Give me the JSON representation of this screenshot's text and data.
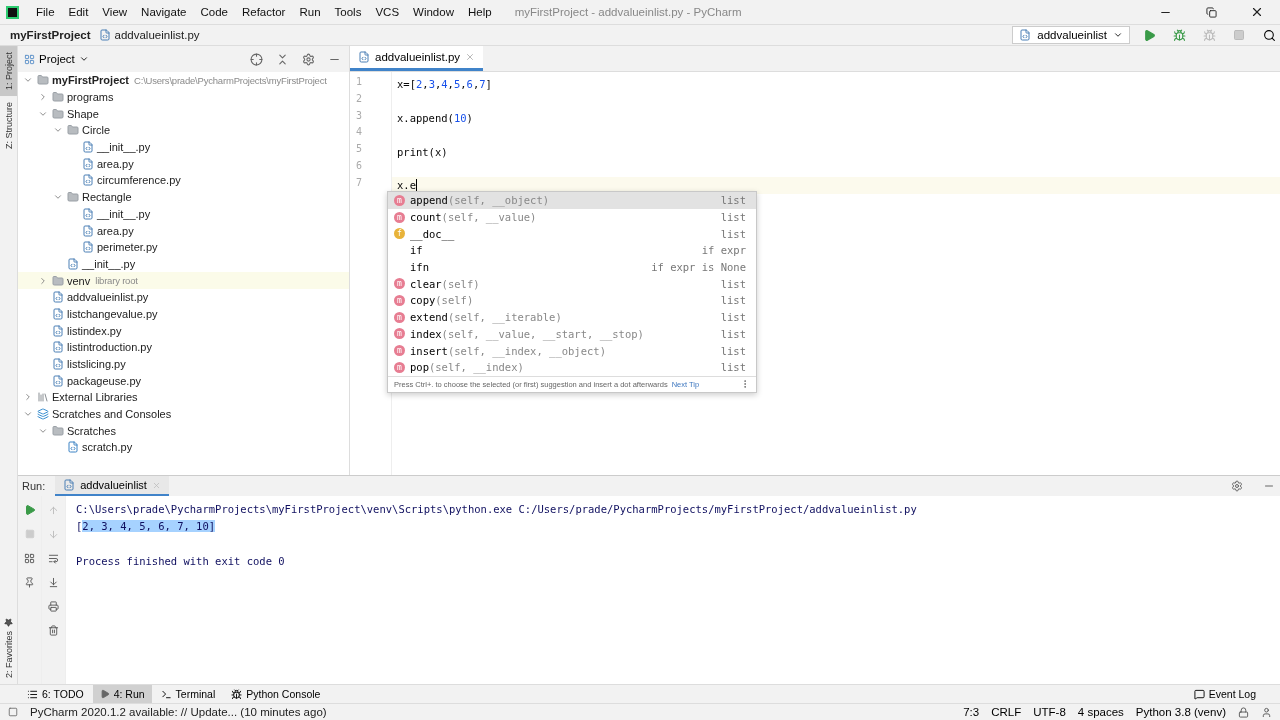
{
  "menu": [
    "File",
    "Edit",
    "View",
    "Navigate",
    "Code",
    "Refactor",
    "Run",
    "Tools",
    "VCS",
    "Window",
    "Help"
  ],
  "window": {
    "title": "myFirstProject - addvalueinlist.py - PyCharm"
  },
  "breadcrumb": [
    {
      "label": "myFirstProject",
      "kind": "project"
    },
    {
      "label": "addvalueinlist.py",
      "kind": "file"
    }
  ],
  "run_config": {
    "label": "addvalueinlist"
  },
  "side_tabs_top": [
    {
      "label": "1: Project",
      "selected": true
    },
    {
      "label": "Z: Structure",
      "selected": false
    }
  ],
  "side_tabs_bottom": [
    {
      "label": "2: Favorites",
      "selected": false
    }
  ],
  "project_panel": {
    "title": "Project",
    "tree": [
      {
        "name": "myFirstProject",
        "kind": "folder",
        "bold": true,
        "note": "C:\\Users\\prade\\PycharmProjects\\myFirstProject",
        "expanded": true,
        "children": [
          {
            "name": "programs",
            "kind": "folder",
            "expanded": false
          },
          {
            "name": "Shape",
            "kind": "folder",
            "expanded": true,
            "children": [
              {
                "name": "Circle",
                "kind": "folder",
                "expanded": true,
                "children": [
                  {
                    "name": "__init__.py",
                    "kind": "file"
                  },
                  {
                    "name": "area.py",
                    "kind": "file"
                  },
                  {
                    "name": "circumference.py",
                    "kind": "file"
                  }
                ]
              },
              {
                "name": "Rectangle",
                "kind": "folder",
                "expanded": true,
                "children": [
                  {
                    "name": "__init__.py",
                    "kind": "file"
                  },
                  {
                    "name": "area.py",
                    "kind": "file"
                  },
                  {
                    "name": "perimeter.py",
                    "kind": "file"
                  }
                ]
              },
              {
                "name": "__init__.py",
                "kind": "file"
              }
            ]
          },
          {
            "name": "venv",
            "kind": "folder",
            "note": "library root",
            "highlighted": true,
            "expanded": false
          },
          {
            "name": "addvalueinlist.py",
            "kind": "file"
          },
          {
            "name": "listchangevalue.py",
            "kind": "file"
          },
          {
            "name": "listindex.py",
            "kind": "file"
          },
          {
            "name": "listintroduction.py",
            "kind": "file"
          },
          {
            "name": "listslicing.py",
            "kind": "file"
          },
          {
            "name": "packageuse.py",
            "kind": "file"
          }
        ]
      },
      {
        "name": "External Libraries",
        "kind": "library",
        "expanded": false
      },
      {
        "name": "Scratches and Consoles",
        "kind": "scratches",
        "expanded": true,
        "children": [
          {
            "name": "Scratches",
            "kind": "folder",
            "expanded": true,
            "children": [
              {
                "name": "scratch.py",
                "kind": "scratch"
              }
            ]
          }
        ]
      }
    ]
  },
  "editor": {
    "tab": "addvalueinlist.py",
    "lines": [
      {
        "number": "1",
        "code": "x=[2,3,4,5,6,7]",
        "current": false
      },
      {
        "number": "2",
        "current": false
      },
      {
        "number": "3",
        "code": "x.append(10)",
        "current": false
      },
      {
        "number": "4",
        "current": false
      },
      {
        "number": "5",
        "code": "print(x)",
        "current": false
      },
      {
        "number": "6",
        "current": false
      },
      {
        "number": "7",
        "code": "x.e",
        "current": true
      }
    ]
  },
  "completion": {
    "items": [
      {
        "kind": "method",
        "icon": "m",
        "name": "append",
        "params": "(self, __object)",
        "type": "list",
        "selected": true
      },
      {
        "kind": "method",
        "icon": "m",
        "name": "count",
        "params": "(self, __value)",
        "type": "list",
        "selected": false
      },
      {
        "kind": "field",
        "icon": "f",
        "name": "__doc__",
        "type": "list",
        "selected": false
      },
      {
        "kind": "template",
        "name": "if",
        "type": "if expr",
        "selected": false
      },
      {
        "kind": "template",
        "name": "ifn",
        "type": "if expr is None",
        "selected": false
      },
      {
        "kind": "method",
        "icon": "m",
        "name": "clear",
        "params": "(self)",
        "type": "list",
        "selected": false
      },
      {
        "kind": "method",
        "icon": "m",
        "name": "copy",
        "params": "(self)",
        "type": "list",
        "selected": false
      },
      {
        "kind": "method",
        "icon": "m",
        "name": "extend",
        "params": "(self, __iterable)",
        "type": "list",
        "selected": false
      },
      {
        "kind": "method",
        "icon": "m",
        "name": "index",
        "params": "(self, __value, __start, __stop)",
        "type": "list",
        "selected": false
      },
      {
        "kind": "method",
        "icon": "m",
        "name": "insert",
        "params": "(self, __index, __object)",
        "type": "list",
        "selected": false
      },
      {
        "kind": "method",
        "icon": "m",
        "name": "pop",
        "params": "(self, __index)",
        "type": "list",
        "selected": false
      }
    ],
    "hint": "Press Ctrl+. to choose the selected (or first) suggestion and insert a dot afterwards",
    "tip_link": "Next Tip"
  },
  "run_panel": {
    "label": "Run:",
    "tab": "addvalueinlist",
    "output": [
      {
        "text": "C:\\Users\\prade\\PycharmProjects\\myFirstProject\\venv\\Scripts\\python.exe C:/Users/prade/PycharmProjects/myFirstProject/addvalueinlist.py"
      },
      {
        "text": "[",
        "selected_text": "2, 3, 4, 5, 6, 7, 10]"
      },
      {
        "text": "Process finished with exit code 0",
        "gap_before": true
      }
    ]
  },
  "tool_tabs": [
    {
      "label": "6: TODO",
      "kind": "todo",
      "selected": false
    },
    {
      "label": "4: Run",
      "kind": "run",
      "selected": true
    },
    {
      "label": "Terminal",
      "kind": "terminal",
      "selected": false
    },
    {
      "label": "Python Console",
      "kind": "console",
      "selected": false
    }
  ],
  "event_log": "Event Log",
  "status_bar": {
    "message": "PyCharm 2020.1.2 available: // Update... (10 minutes ago)",
    "items": [
      "7:3",
      "CRLF",
      "UTF-8",
      "4 spaces",
      "Python 3.8 (venv)"
    ]
  }
}
